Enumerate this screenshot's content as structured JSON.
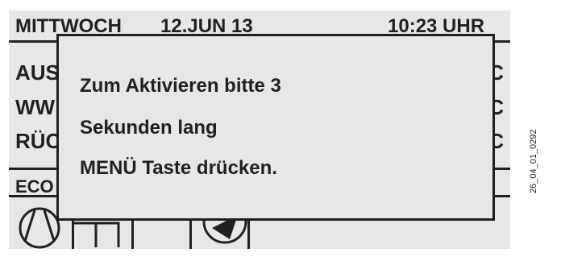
{
  "header": {
    "day": "MITTWOCH",
    "date": "12.JUN 13",
    "time": "10:23 UHR"
  },
  "rows": [
    {
      "label": "AUS",
      "unit": "°C"
    },
    {
      "label": "WW",
      "unit": "°C"
    },
    {
      "label": "RÜC",
      "unit": "°C"
    }
  ],
  "status_label": "ECO",
  "dialog": {
    "lines": [
      "Zum Aktivieren bitte 3",
      "Sekunden lang",
      "MENÜ Taste drücken."
    ]
  },
  "reference_code": "26_04_01_0292",
  "icons": {
    "compressor": "compressor-icon",
    "pump": "pump-icon"
  },
  "colors": {
    "display_bg": "#e6e7e8",
    "foreground": "#231f20"
  }
}
